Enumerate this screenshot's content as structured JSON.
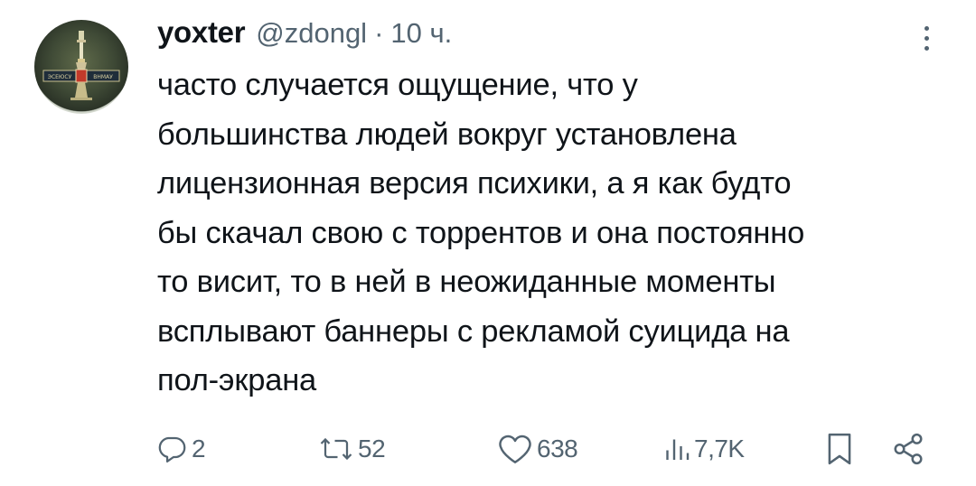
{
  "tweet": {
    "author_name": "yoxter",
    "author_handle": "@zdongl",
    "separator": "·",
    "time": "10 ч.",
    "text_lines": [
      "часто случается ощущение, что у",
      "большинства людей вокруг установлена",
      "лицензионная версия психики, а я как будто",
      "бы скачал свою с торрентов и она постоянно",
      "то висит, то в ней в неожиданные моменты",
      "всплывают баннеры с рекламой суицида на",
      "пол-экрана"
    ],
    "avatar_badge_text": "ЭСЕЮСУ ВНМАУ"
  },
  "actions": {
    "replies": {
      "icon": "reply-icon",
      "count": "2"
    },
    "reposts": {
      "icon": "repost-icon",
      "count": "52"
    },
    "likes": {
      "icon": "heart-icon",
      "count": "638"
    },
    "views": {
      "icon": "views-icon",
      "count": "7,7K"
    },
    "bookmark": {
      "icon": "bookmark-icon"
    },
    "share": {
      "icon": "share-icon"
    }
  },
  "colors": {
    "text_primary": "#0f1419",
    "text_secondary": "#536471",
    "background": "#ffffff"
  }
}
